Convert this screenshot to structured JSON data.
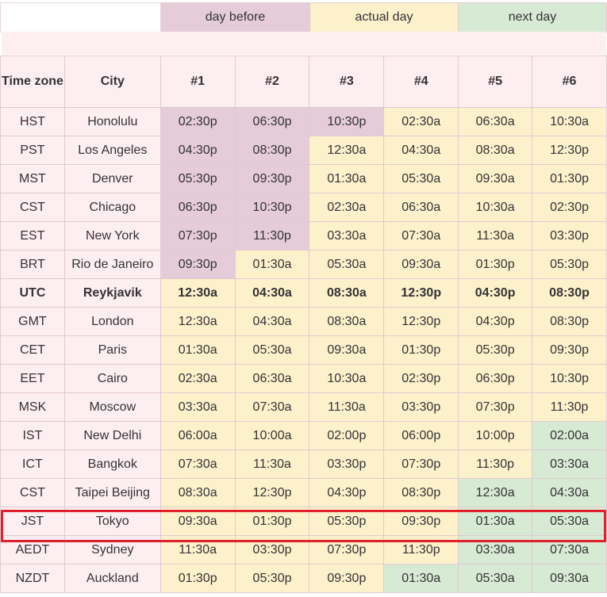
{
  "legend": {
    "before": "day before",
    "actual": "actual day",
    "next": "next day"
  },
  "headers": {
    "timezone": "Time zone",
    "city": "City",
    "slots": [
      "#1",
      "#2",
      "#3",
      "#4",
      "#5",
      "#6"
    ]
  },
  "colors": {
    "before": "#e5ccd8",
    "actual": "#fdf1cc",
    "next": "#d7ead4",
    "label_bg": "#fdeef2",
    "highlight": "#e0202a"
  },
  "highlighted_row": "Tokyo",
  "rows": [
    {
      "tz": "HST",
      "city": "Honolulu",
      "times": [
        "02:30p",
        "06:30p",
        "10:30p",
        "02:30a",
        "06:30a",
        "10:30a"
      ],
      "days": [
        "b",
        "b",
        "b",
        "a",
        "a",
        "a"
      ]
    },
    {
      "tz": "PST",
      "city": "Los Angeles",
      "times": [
        "04:30p",
        "08:30p",
        "12:30a",
        "04:30a",
        "08:30a",
        "12:30p"
      ],
      "days": [
        "b",
        "b",
        "a",
        "a",
        "a",
        "a"
      ]
    },
    {
      "tz": "MST",
      "city": "Denver",
      "times": [
        "05:30p",
        "09:30p",
        "01:30a",
        "05:30a",
        "09:30a",
        "01:30p"
      ],
      "days": [
        "b",
        "b",
        "a",
        "a",
        "a",
        "a"
      ]
    },
    {
      "tz": "CST",
      "city": "Chicago",
      "times": [
        "06:30p",
        "10:30p",
        "02:30a",
        "06:30a",
        "10:30a",
        "02:30p"
      ],
      "days": [
        "b",
        "b",
        "a",
        "a",
        "a",
        "a"
      ]
    },
    {
      "tz": "EST",
      "city": "New York",
      "times": [
        "07:30p",
        "11:30p",
        "03:30a",
        "07:30a",
        "11:30a",
        "03:30p"
      ],
      "days": [
        "b",
        "b",
        "a",
        "a",
        "a",
        "a"
      ]
    },
    {
      "tz": "BRT",
      "city": "Rio de Janeiro",
      "times": [
        "09:30p",
        "01:30a",
        "05:30a",
        "09:30a",
        "01:30p",
        "05:30p"
      ],
      "days": [
        "b",
        "a",
        "a",
        "a",
        "a",
        "a"
      ]
    },
    {
      "tz": "UTC",
      "city": "Reykjavik",
      "times": [
        "12:30a",
        "04:30a",
        "08:30a",
        "12:30p",
        "04:30p",
        "08:30p"
      ],
      "days": [
        "a",
        "a",
        "a",
        "a",
        "a",
        "a"
      ],
      "bold": true
    },
    {
      "tz": "GMT",
      "city": "London",
      "times": [
        "12:30a",
        "04:30a",
        "08:30a",
        "12:30p",
        "04:30p",
        "08:30p"
      ],
      "days": [
        "a",
        "a",
        "a",
        "a",
        "a",
        "a"
      ]
    },
    {
      "tz": "CET",
      "city": "Paris",
      "times": [
        "01:30a",
        "05:30a",
        "09:30a",
        "01:30p",
        "05:30p",
        "09:30p"
      ],
      "days": [
        "a",
        "a",
        "a",
        "a",
        "a",
        "a"
      ]
    },
    {
      "tz": "EET",
      "city": "Cairo",
      "times": [
        "02:30a",
        "06:30a",
        "10:30a",
        "02:30p",
        "06:30p",
        "10:30p"
      ],
      "days": [
        "a",
        "a",
        "a",
        "a",
        "a",
        "a"
      ]
    },
    {
      "tz": "MSK",
      "city": "Moscow",
      "times": [
        "03:30a",
        "07:30a",
        "11:30a",
        "03:30p",
        "07:30p",
        "11:30p"
      ],
      "days": [
        "a",
        "a",
        "a",
        "a",
        "a",
        "a"
      ]
    },
    {
      "tz": "IST",
      "city": "New Delhi",
      "times": [
        "06:00a",
        "10:00a",
        "02:00p",
        "06:00p",
        "10:00p",
        "02:00a"
      ],
      "days": [
        "a",
        "a",
        "a",
        "a",
        "a",
        "n"
      ]
    },
    {
      "tz": "ICT",
      "city": "Bangkok",
      "times": [
        "07:30a",
        "11:30a",
        "03:30p",
        "07:30p",
        "11:30p",
        "03:30a"
      ],
      "days": [
        "a",
        "a",
        "a",
        "a",
        "a",
        "n"
      ]
    },
    {
      "tz": "CST",
      "city": "Taipei Beijing",
      "times": [
        "08:30a",
        "12:30p",
        "04:30p",
        "08:30p",
        "12:30a",
        "04:30a"
      ],
      "days": [
        "a",
        "a",
        "a",
        "a",
        "n",
        "n"
      ]
    },
    {
      "tz": "JST",
      "city": "Tokyo",
      "times": [
        "09:30a",
        "01:30p",
        "05:30p",
        "09:30p",
        "01:30a",
        "05:30a"
      ],
      "days": [
        "a",
        "a",
        "a",
        "a",
        "n",
        "n"
      ]
    },
    {
      "tz": "AEDT",
      "city": "Sydney",
      "times": [
        "11:30a",
        "03:30p",
        "07:30p",
        "11:30p",
        "03:30a",
        "07:30a"
      ],
      "days": [
        "a",
        "a",
        "a",
        "a",
        "n",
        "n"
      ]
    },
    {
      "tz": "NZDT",
      "city": "Auckland",
      "times": [
        "01:30p",
        "05:30p",
        "09:30p",
        "01:30a",
        "05:30a",
        "09:30a"
      ],
      "days": [
        "a",
        "a",
        "a",
        "n",
        "n",
        "n"
      ]
    }
  ]
}
